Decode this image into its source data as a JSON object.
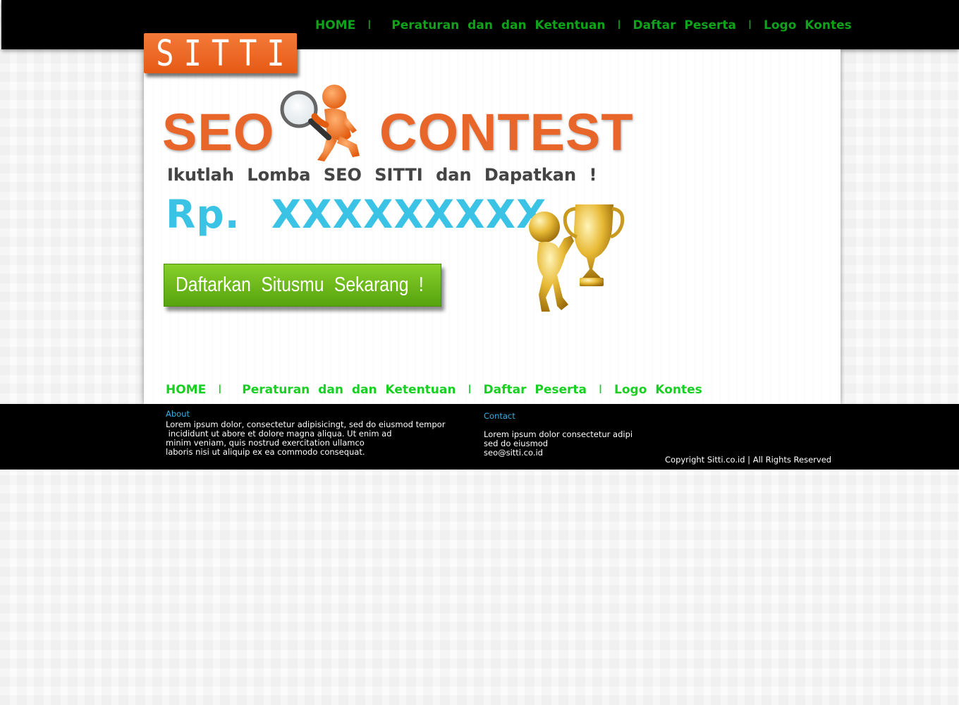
{
  "nav": {
    "home": "HOME",
    "rules": "Peraturan  dan  dan  Ketentuan",
    "participants": "Daftar  Peserta",
    "logo": "Logo  Kontes",
    "separator": "I"
  },
  "brand": {
    "logo_text": "SITTI"
  },
  "hero": {
    "title_seo": "SEO",
    "title_contest": "CONTEST",
    "tagline": "Ikutlah  Lomba  SEO  SITTI  dan  Dapatkan !",
    "prize": "Rp.  XXXXXXXXX",
    "cta": "Daftarkan  Situsmu  Sekarang !"
  },
  "footer": {
    "about_title": "About",
    "about_text": "Lorem ipsum dolor, consectetur adipisicingt, sed do eiusmod tempor\n incididunt ut abore et dolore magna aliqua. Ut enim ad\nminim veniam, quis nostrud exercitation ullamco\nlaboris nisi ut aliquip ex ea commodo consequat.",
    "contact_title": "Contact",
    "contact_text": "Lorem ipsum dolor consectetur adipi\nsed do eiusmod\nseo@sitti.co.id",
    "copyright": "Copyright Sitti.co.id | All Rights Reserved"
  },
  "colors": {
    "nav_top": "#0fa21b",
    "nav_bottom": "#17d021",
    "brand_orange": "#e8662a",
    "prize_blue": "#3bc3e6",
    "cta_green": "#6bbb1b"
  }
}
